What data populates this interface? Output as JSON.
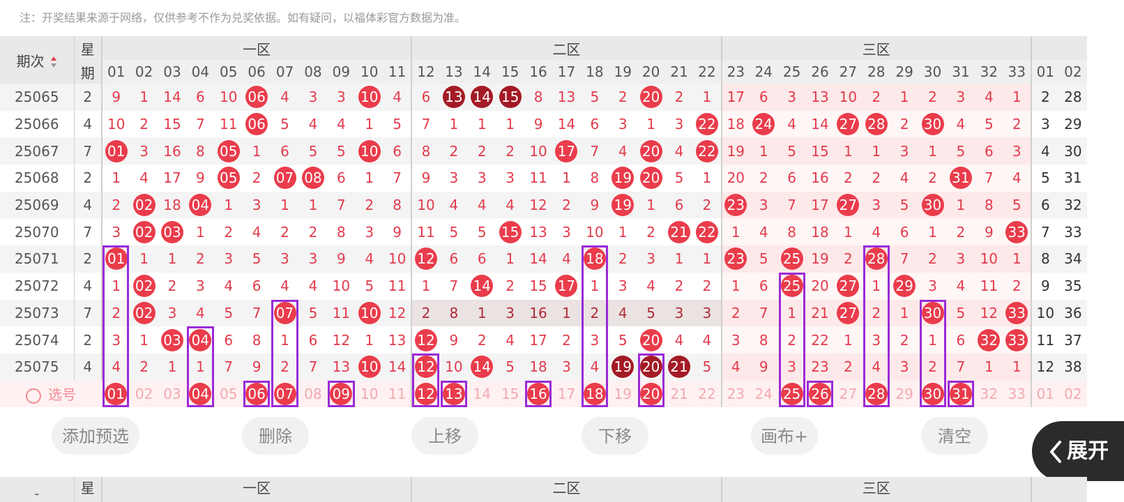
{
  "note": "注：开奖结果来源于网络，仅供参考不作为兑奖依据。如有疑问，以福体彩官方数据为准。",
  "header": {
    "period": "期次",
    "week_top": "星",
    "week_bottom": "期",
    "zones": [
      "一区",
      "二区",
      "三区"
    ]
  },
  "red_numbers": [
    "01",
    "02",
    "03",
    "04",
    "05",
    "06",
    "07",
    "08",
    "09",
    "10",
    "11",
    "12",
    "13",
    "14",
    "15",
    "16",
    "17",
    "18",
    "19",
    "20",
    "21",
    "22",
    "23",
    "24",
    "25",
    "26",
    "27",
    "28",
    "29",
    "30",
    "31",
    "32",
    "33"
  ],
  "blue_numbers": [
    "01",
    "02"
  ],
  "rows": [
    {
      "issue": "25065",
      "week": "2",
      "cells": [
        "9",
        "1",
        "14",
        "6",
        "10",
        "●",
        "4",
        "3",
        "3",
        "●",
        "4",
        "6",
        "◆",
        "◆",
        "◆",
        "8",
        "13",
        "5",
        "2",
        "●",
        "2",
        "1",
        "17",
        "6",
        "3",
        "13",
        "10",
        "2",
        "1",
        "2",
        "3",
        "4",
        "1"
      ],
      "blue": [
        "2",
        "28"
      ]
    },
    {
      "issue": "25066",
      "week": "4",
      "cells": [
        "10",
        "2",
        "15",
        "7",
        "11",
        "●",
        "5",
        "4",
        "4",
        "1",
        "5",
        "7",
        "1",
        "1",
        "1",
        "9",
        "14",
        "6",
        "3",
        "1",
        "3",
        "●",
        "18",
        "●",
        "4",
        "14",
        "●",
        "●",
        "2",
        "●",
        "4",
        "5",
        "2"
      ],
      "blue": [
        "3",
        "29"
      ]
    },
    {
      "issue": "25067",
      "week": "7",
      "cells": [
        "●",
        "3",
        "16",
        "8",
        "●",
        "1",
        "6",
        "5",
        "5",
        "●",
        "6",
        "8",
        "2",
        "2",
        "2",
        "10",
        "●",
        "7",
        "4",
        "●",
        "4",
        "●",
        "19",
        "1",
        "5",
        "15",
        "1",
        "1",
        "3",
        "1",
        "5",
        "6",
        "3"
      ],
      "blue": [
        "4",
        "30"
      ]
    },
    {
      "issue": "25068",
      "week": "2",
      "cells": [
        "1",
        "4",
        "17",
        "9",
        "●",
        "2",
        "●",
        "●",
        "6",
        "1",
        "7",
        "9",
        "3",
        "3",
        "3",
        "11",
        "1",
        "8",
        "●",
        "●",
        "5",
        "1",
        "20",
        "2",
        "6",
        "16",
        "2",
        "2",
        "4",
        "2",
        "●",
        "7",
        "4"
      ],
      "blue": [
        "5",
        "31"
      ]
    },
    {
      "issue": "25069",
      "week": "4",
      "cells": [
        "2",
        "●",
        "18",
        "●",
        "1",
        "3",
        "1",
        "1",
        "7",
        "2",
        "8",
        "10",
        "4",
        "4",
        "4",
        "12",
        "2",
        "9",
        "●",
        "1",
        "6",
        "2",
        "●",
        "3",
        "7",
        "17",
        "●",
        "3",
        "5",
        "●",
        "1",
        "8",
        "5"
      ],
      "blue": [
        "6",
        "32"
      ]
    },
    {
      "issue": "25070",
      "week": "7",
      "cells": [
        "3",
        "●",
        "●",
        "1",
        "2",
        "4",
        "2",
        "2",
        "8",
        "3",
        "9",
        "11",
        "5",
        "5",
        "●",
        "13",
        "3",
        "10",
        "1",
        "2",
        "●",
        "●",
        "1",
        "4",
        "8",
        "18",
        "1",
        "4",
        "6",
        "1",
        "2",
        "9",
        "●"
      ],
      "blue": [
        "7",
        "33"
      ]
    },
    {
      "issue": "25071",
      "week": "2",
      "cells": [
        "●",
        "1",
        "1",
        "2",
        "3",
        "5",
        "3",
        "3",
        "9",
        "4",
        "10",
        "●",
        "6",
        "6",
        "1",
        "14",
        "4",
        "●",
        "2",
        "3",
        "1",
        "1",
        "●",
        "5",
        "●",
        "19",
        "2",
        "●",
        "7",
        "2",
        "3",
        "10",
        "1"
      ],
      "blue": [
        "8",
        "34"
      ]
    },
    {
      "issue": "25072",
      "week": "4",
      "cells": [
        "1",
        "●",
        "2",
        "3",
        "4",
        "6",
        "4",
        "4",
        "10",
        "5",
        "11",
        "1",
        "7",
        "●",
        "2",
        "15",
        "●",
        "1",
        "3",
        "4",
        "2",
        "2",
        "1",
        "6",
        "●",
        "20",
        "●",
        "1",
        "●",
        "3",
        "4",
        "11",
        "2"
      ],
      "blue": [
        "9",
        "35"
      ]
    },
    {
      "issue": "25073",
      "week": "7",
      "cells": [
        "2",
        "●",
        "3",
        "4",
        "5",
        "7",
        "●",
        "5",
        "11",
        "●",
        "12",
        "2",
        "8",
        "1",
        "3",
        "16",
        "1",
        "2",
        "4",
        "5",
        "3",
        "3",
        "2",
        "7",
        "1",
        "21",
        "●",
        "2",
        "1",
        "●",
        "5",
        "12",
        "●"
      ],
      "blue": [
        "10",
        "36"
      ]
    },
    {
      "issue": "25074",
      "week": "2",
      "cells": [
        "3",
        "1",
        "●",
        "●",
        "6",
        "8",
        "1",
        "6",
        "12",
        "1",
        "13",
        "●",
        "9",
        "2",
        "4",
        "17",
        "2",
        "3",
        "5",
        "●",
        "4",
        "4",
        "3",
        "8",
        "2",
        "22",
        "1",
        "3",
        "2",
        "1",
        "6",
        "●",
        "●"
      ],
      "blue": [
        "11",
        "37"
      ]
    },
    {
      "issue": "25075",
      "week": "4",
      "cells": [
        "4",
        "2",
        "1",
        "1",
        "7",
        "9",
        "2",
        "7",
        "13",
        "●",
        "14",
        "●",
        "10",
        "●",
        "5",
        "18",
        "3",
        "4",
        "◆",
        "◆",
        "◆",
        "5",
        "4",
        "9",
        "3",
        "23",
        "2",
        "4",
        "3",
        "2",
        "7",
        "1",
        "1"
      ],
      "blue": [
        "12",
        "38"
      ]
    }
  ],
  "select_row": {
    "label": "选号",
    "selected": [
      "01",
      "04",
      "06",
      "07",
      "09",
      "12",
      "13",
      "16",
      "18",
      "20",
      "25",
      "26",
      "28",
      "30",
      "31"
    ]
  },
  "buttons": {
    "add": "添加预选",
    "delete": "删除",
    "up": "上移",
    "down": "下移",
    "canvas": "画布+",
    "clear": "清空",
    "expand": "展开"
  },
  "colors": {
    "red_ball": "#ea3c4b",
    "dark_ball": "#a31a25",
    "highlight": "#9b2ad8",
    "miss_text": "#e23b4c"
  }
}
